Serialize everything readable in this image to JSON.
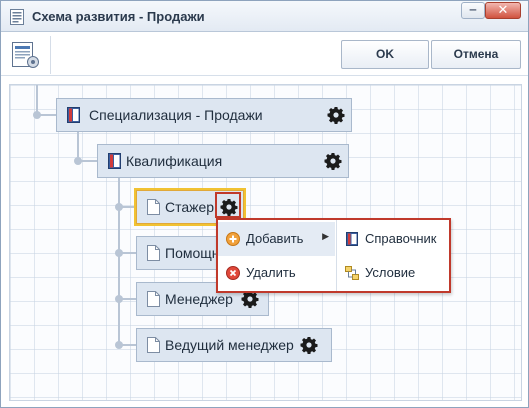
{
  "window": {
    "title": "Схема развития - Продажи",
    "minimize_glyph": "‒",
    "close_glyph": "✕"
  },
  "toolbar": {
    "ok_label": "OK",
    "cancel_label": "Отмена",
    "doc_icon": "document-settings-icon"
  },
  "tree": {
    "root": {
      "label": "Специализация - Продажи",
      "icon": "book-icon"
    },
    "level1": {
      "label": "Квалификация",
      "icon": "book-icon"
    },
    "items": [
      {
        "label": "Стажер",
        "icon": "page-icon",
        "selected": true
      },
      {
        "label": "Помощн",
        "icon": "page-icon"
      },
      {
        "label": "Менеджер",
        "icon": "page-icon"
      },
      {
        "label": "Ведущий менеджер",
        "icon": "page-icon"
      }
    ]
  },
  "context_menu": {
    "add_label": "Добавить",
    "remove_label": "Удалить",
    "submenu": [
      {
        "label": "Справочник",
        "icon": "book-icon"
      },
      {
        "label": "Условие",
        "icon": "condition-icon"
      }
    ]
  },
  "colors": {
    "accent": "#c0392b",
    "node_bg": "#dde6f1",
    "selected_outline": "#f1c232"
  }
}
